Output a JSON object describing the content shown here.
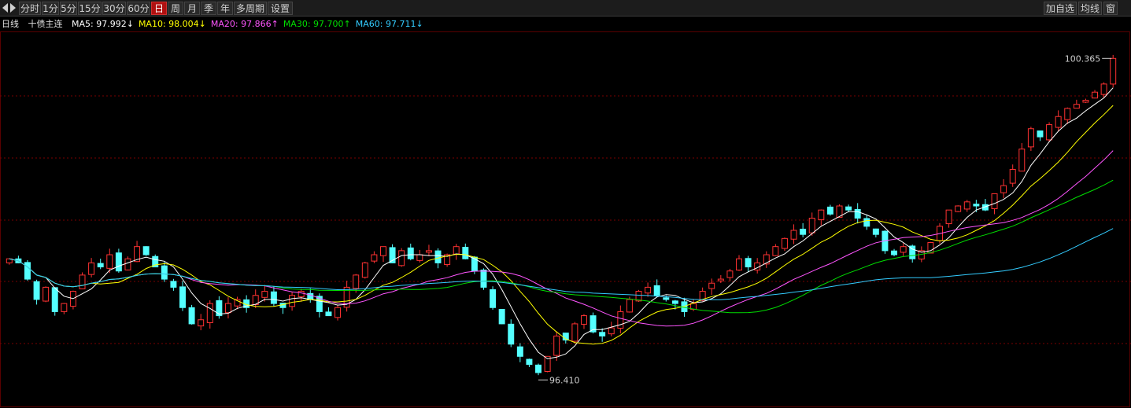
{
  "toolbar": {
    "periods": [
      "分时",
      "1分",
      "5分",
      "15分",
      "30分",
      "60分",
      "日",
      "周",
      "月",
      "季",
      "年",
      "多周期",
      "设置"
    ],
    "active_period": "日",
    "right_buttons": [
      "加自选",
      "均线",
      "窗"
    ]
  },
  "info": {
    "period_label": "日线",
    "symbol": "十债主连",
    "ma": [
      {
        "label": "MA5: 97.992",
        "arrow": "↓",
        "color": "#ffffff"
      },
      {
        "label": "MA10: 98.004",
        "arrow": "↓",
        "color": "#ffff00"
      },
      {
        "label": "MA20: 97.866",
        "arrow": "↑",
        "color": "#ff55ff"
      },
      {
        "label": "MA30: 97.700",
        "arrow": "↑",
        "color": "#00dd00"
      },
      {
        "label": "MA60: 97.711",
        "arrow": "↓",
        "color": "#33ccff"
      }
    ]
  },
  "colors": {
    "up": "#ff3232",
    "down": "#54ffff",
    "grid": "#7a0000"
  },
  "chart_data": {
    "type": "candlestick",
    "ylim": [
      96.2,
      100.6
    ],
    "annotations": [
      {
        "label": "100.365",
        "price": 100.365
      },
      {
        "label": "96.410",
        "price": 96.41
      }
    ],
    "series": [
      {
        "name": "MA5",
        "color": "#ffffff"
      },
      {
        "name": "MA10",
        "color": "#ffff00"
      },
      {
        "name": "MA20",
        "color": "#ff55ff"
      },
      {
        "name": "MA30",
        "color": "#00dd00"
      },
      {
        "name": "MA60",
        "color": "#33ccff"
      }
    ],
    "closes": [
      97.9,
      97.85,
      97.65,
      97.4,
      97.55,
      97.25,
      97.35,
      97.5,
      97.7,
      97.85,
      97.8,
      97.95,
      97.75,
      97.9,
      98.05,
      97.95,
      97.8,
      97.65,
      97.55,
      97.3,
      97.1,
      97.15,
      97.35,
      97.2,
      97.35,
      97.4,
      97.3,
      97.45,
      97.5,
      97.35,
      97.3,
      97.45,
      97.5,
      97.4,
      97.25,
      97.2,
      97.3,
      97.55,
      97.7,
      97.85,
      97.95,
      98.05,
      97.85,
      98,
      97.9,
      97.95,
      98.0,
      97.85,
      97.95,
      98.05,
      97.9,
      97.75,
      97.55,
      97.3,
      97.1,
      96.85,
      96.7,
      96.6,
      96.5,
      96.7,
      96.95,
      96.9,
      97.1,
      97.2,
      97.0,
      96.95,
      97.05,
      97.25,
      97.4,
      97.5,
      97.55,
      97.45,
      97.4,
      97.35,
      97.25,
      97.35,
      97.5,
      97.6,
      97.65,
      97.75,
      97.9,
      97.8,
      97.85,
      97.95,
      98.05,
      98.15,
      98.25,
      98.2,
      98.4,
      98.5,
      98.45,
      98.55,
      98.5,
      98.4,
      98.3,
      98.2,
      98.0,
      97.95,
      98.05,
      97.9,
      98.0,
      98.1,
      98.3,
      98.5,
      98.55,
      98.6,
      98.55,
      98.5,
      98.7,
      98.8,
      99.0,
      99.25,
      99.5,
      99.4,
      99.55,
      99.65,
      99.75,
      99.8,
      99.85,
      99.95,
      100.05,
      100.365
    ]
  }
}
